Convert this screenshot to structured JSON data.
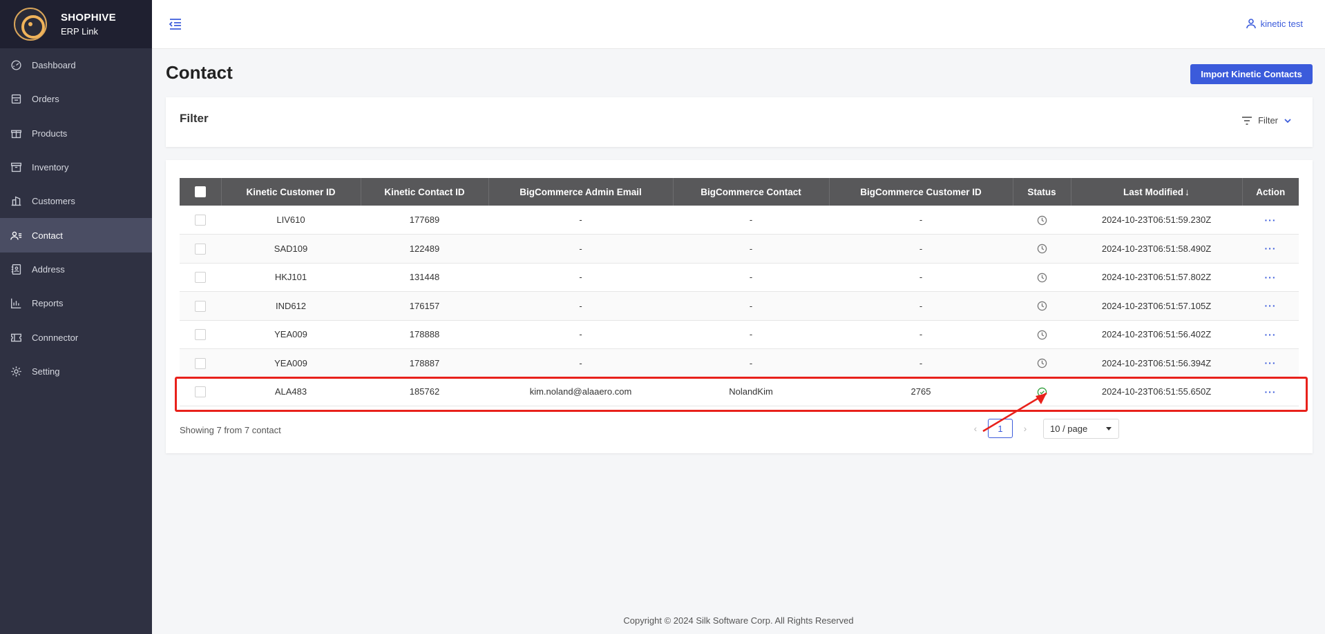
{
  "brand": {
    "name": "SHOPHIVE",
    "sub": "ERP Link"
  },
  "sidebar": {
    "items": [
      {
        "label": "Dashboard",
        "icon": "dashboard-icon"
      },
      {
        "label": "Orders",
        "icon": "orders-icon"
      },
      {
        "label": "Products",
        "icon": "gift-icon"
      },
      {
        "label": "Inventory",
        "icon": "archive-icon"
      },
      {
        "label": "Customers",
        "icon": "building-icon"
      },
      {
        "label": "Contact",
        "icon": "contacts-icon",
        "active": true
      },
      {
        "label": "Address",
        "icon": "address-book-icon"
      },
      {
        "label": "Reports",
        "icon": "bar-chart-icon"
      },
      {
        "label": "Connnector",
        "icon": "ticket-icon"
      },
      {
        "label": "Setting",
        "icon": "gear-icon"
      }
    ]
  },
  "header": {
    "user": "kinetic test"
  },
  "page": {
    "title": "Contact",
    "import_label": "Import Kinetic Contacts"
  },
  "filter": {
    "title": "Filter",
    "button_label": "Filter"
  },
  "table": {
    "columns": [
      "Kinetic Customer ID",
      "Kinetic Contact ID",
      "BigCommerce Admin Email",
      "BigCommerce Contact",
      "BigCommerce Customer ID",
      "Status",
      "Last Modified",
      "Action"
    ],
    "sort_indicator": "↓",
    "rows": [
      {
        "customer_id": "LIV610",
        "contact_id": "177689",
        "email": "-",
        "contact": "-",
        "bc_customer_id": "-",
        "status": "pending",
        "modified": "2024-10-23T06:51:59.230Z"
      },
      {
        "customer_id": "SAD109",
        "contact_id": "122489",
        "email": "-",
        "contact": "-",
        "bc_customer_id": "-",
        "status": "pending",
        "modified": "2024-10-23T06:51:58.490Z"
      },
      {
        "customer_id": "HKJ101",
        "contact_id": "131448",
        "email": "-",
        "contact": "-",
        "bc_customer_id": "-",
        "status": "pending",
        "modified": "2024-10-23T06:51:57.802Z"
      },
      {
        "customer_id": "IND612",
        "contact_id": "176157",
        "email": "-",
        "contact": "-",
        "bc_customer_id": "-",
        "status": "pending",
        "modified": "2024-10-23T06:51:57.105Z"
      },
      {
        "customer_id": "YEA009",
        "contact_id": "178888",
        "email": "-",
        "contact": "-",
        "bc_customer_id": "-",
        "status": "pending",
        "modified": "2024-10-23T06:51:56.402Z"
      },
      {
        "customer_id": "YEA009",
        "contact_id": "178887",
        "email": "-",
        "contact": "-",
        "bc_customer_id": "-",
        "status": "pending",
        "modified": "2024-10-23T06:51:56.394Z"
      },
      {
        "customer_id": "ALA483",
        "contact_id": "185762",
        "email": "kim.noland@alaaero.com",
        "contact": "NolandKim",
        "bc_customer_id": "2765",
        "status": "success",
        "modified": "2024-10-23T06:51:55.650Z"
      }
    ],
    "action_label": "···"
  },
  "pagination": {
    "summary": "Showing 7 from 7 contact",
    "current_page": "1",
    "page_size": "10 / page"
  },
  "colors": {
    "accent": "#3b5bdb",
    "sidebar": "#2f3142",
    "header_row": "#58585a",
    "success": "#2e9e3a",
    "highlight": "#e8211b"
  },
  "footer": {
    "copyright": "Copyright © 2024 Silk Software Corp. All Rights Reserved"
  }
}
